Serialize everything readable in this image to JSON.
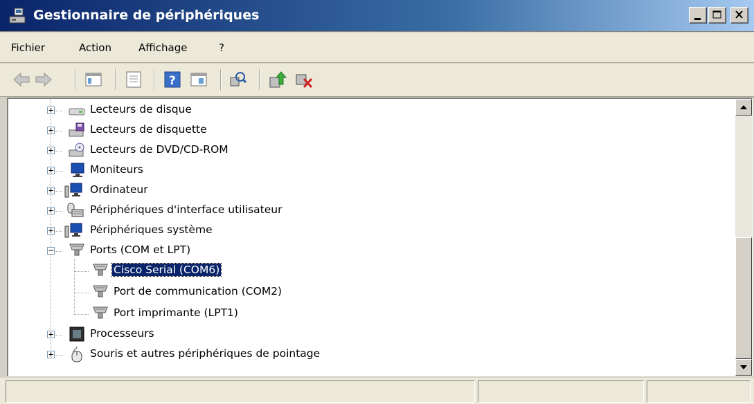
{
  "window": {
    "title": "Gestionnaire de périphériques"
  },
  "menu": {
    "items": [
      "Fichier",
      "Action",
      "Affichage",
      "?"
    ]
  },
  "toolbar": {
    "buttons": [
      "back-icon",
      "forward-icon",
      "console-tree-icon",
      "properties-icon",
      "help-icon",
      "show-hide-icon",
      "scan-hardware-icon",
      "update-driver-icon",
      "uninstall-icon"
    ]
  },
  "tree": {
    "categories": [
      {
        "label": "Lecteurs de disque",
        "icon": "disk-drive-icon",
        "expanded": false
      },
      {
        "label": "Lecteurs de disquette",
        "icon": "floppy-drive-icon",
        "expanded": false
      },
      {
        "label": "Lecteurs de DVD/CD-ROM",
        "icon": "dvd-drive-icon",
        "expanded": false
      },
      {
        "label": "Moniteurs",
        "icon": "monitor-icon",
        "expanded": false
      },
      {
        "label": "Ordinateur",
        "icon": "computer-icon",
        "expanded": false
      },
      {
        "label": "Périphériques d'interface utilisateur",
        "icon": "hid-icon",
        "expanded": false
      },
      {
        "label": "Périphériques système",
        "icon": "system-device-icon",
        "expanded": false
      },
      {
        "label": "Ports (COM et LPT)",
        "icon": "port-icon",
        "expanded": true
      },
      {
        "label": "Cisco Serial (COM6)",
        "icon": "port-icon",
        "child": true,
        "selected": true
      },
      {
        "label": "Port de communication (COM2)",
        "icon": "port-icon",
        "child": true
      },
      {
        "label": "Port imprimante (LPT1)",
        "icon": "port-icon",
        "child": true
      },
      {
        "label": "Processeurs",
        "icon": "processor-icon",
        "expanded": false
      },
      {
        "label": "Souris et autres périphériques de pointage",
        "icon": "mouse-icon",
        "expanded": false
      }
    ]
  },
  "colors": {
    "selection": "#0a246a",
    "titlebar": "#0a246a"
  }
}
